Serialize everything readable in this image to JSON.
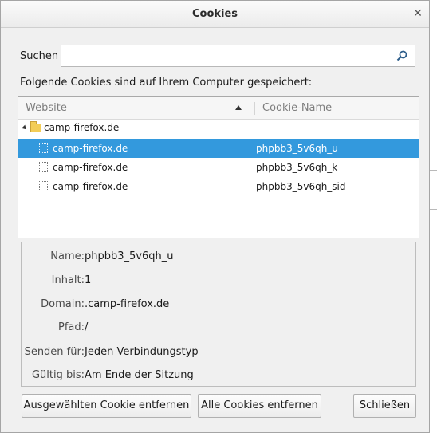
{
  "window": {
    "title": "Cookies"
  },
  "search": {
    "label": "Suchen",
    "value": "",
    "placeholder": ""
  },
  "intro_text": "Folgende Cookies sind auf Ihrem Computer gespeichert:",
  "tree": {
    "columns": {
      "website": "Website",
      "cookie_name": "Cookie-Name"
    },
    "folder": {
      "site": "camp-firefox.de"
    },
    "rows": [
      {
        "site": "camp-firefox.de",
        "name": "phpbb3_5v6qh_u",
        "selected": true
      },
      {
        "site": "camp-firefox.de",
        "name": "phpbb3_5v6qh_k",
        "selected": false
      },
      {
        "site": "camp-firefox.de",
        "name": "phpbb3_5v6qh_sid",
        "selected": false
      }
    ]
  },
  "details": {
    "name_label": "Name:",
    "name_value": "phpbb3_5v6qh_u",
    "content_label": "Inhalt:",
    "content_value": "1",
    "domain_label": "Domain:",
    "domain_value": ".camp-firefox.de",
    "path_label": "Pfad:",
    "path_value": "/",
    "send_label": "Senden für:",
    "send_value": "Jeden Verbindungstyp",
    "expires_label": "Gültig bis:",
    "expires_value": "Am Ende der Sitzung"
  },
  "buttons": {
    "remove_selected": "Ausgewählten Cookie entfernen",
    "remove_all": "Alle Cookies entfernen",
    "close": "Schließen"
  },
  "colors": {
    "selection": "#3399dd"
  }
}
